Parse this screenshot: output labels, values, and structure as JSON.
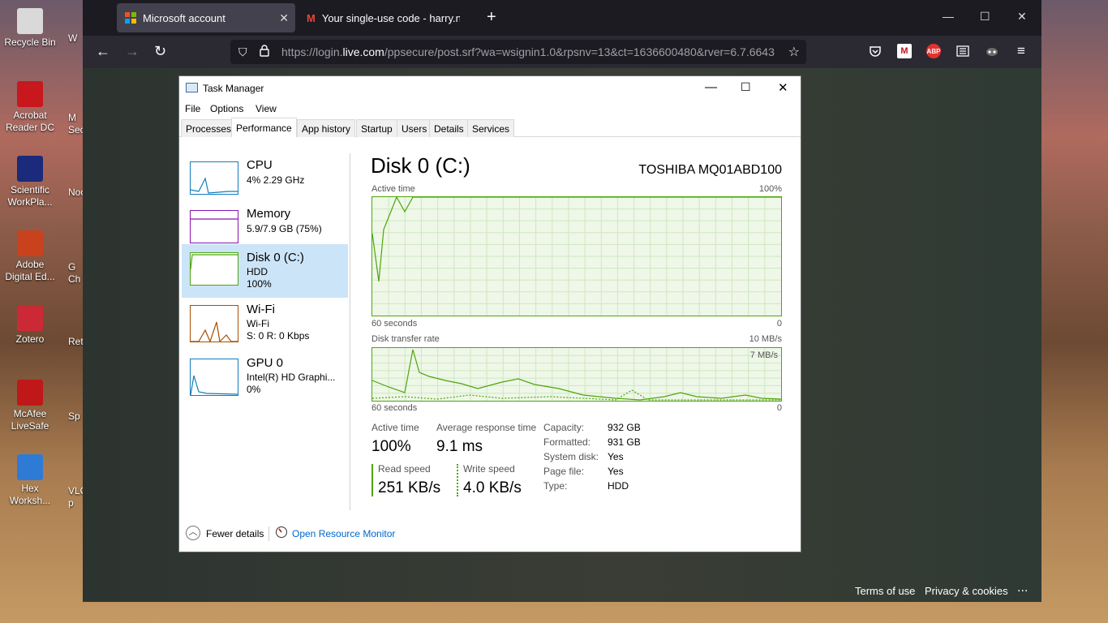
{
  "desktop": {
    "icons": [
      {
        "label": "Recycle Bin",
        "color": "#d9d9d9"
      },
      {
        "label": "Acrobat Reader DC",
        "color": "#c8171d"
      },
      {
        "label": "Scientific WorkPla...",
        "color": "#1b2a7a"
      },
      {
        "label": "Adobe Digital Ed...",
        "color": "#c8421d"
      },
      {
        "label": "Zotero",
        "color": "#cc2936"
      },
      {
        "label": "McAfee LiveSafe",
        "color": "#c01818"
      },
      {
        "label": "Hex Worksh...",
        "color": "#2e7bd6"
      }
    ],
    "cut_labels": [
      "W",
      "M",
      "Secu",
      "Noo",
      "G",
      "Ch",
      "Ret",
      "Sp",
      "VLC",
      "p"
    ]
  },
  "browser": {
    "tabs": [
      {
        "title": "Microsoft account",
        "icon": "microsoft-logo",
        "active": true
      },
      {
        "title": "Your single-use code - harry.no",
        "icon": "gmail-icon",
        "active": false
      }
    ],
    "new_tab": "+",
    "url_prefix": "https://login.",
    "url_domain": "live.com",
    "url_rest": "/ppsecure/post.srf?wa=wsignin1.0&rpsnv=13&ct=1636600480&rver=6.7.6643",
    "toolbar_icons": [
      "pocket-icon",
      "mcafee-icon",
      "abp-icon",
      "reader-icon",
      "privacy-badger-icon",
      "menu-icon"
    ],
    "abp_label": "ABP",
    "footer_links": [
      "Terms of use",
      "Privacy & cookies"
    ],
    "footer_more": "..."
  },
  "task_manager": {
    "title": "Task Manager",
    "menu": [
      "File",
      "Options",
      "View"
    ],
    "tabs": [
      "Processes",
      "Performance",
      "App history",
      "Startup",
      "Users",
      "Details",
      "Services"
    ],
    "active_tab": "Performance",
    "sidebar": [
      {
        "name": "CPU",
        "line1": "4%  2.29 GHz",
        "line2": "",
        "color": "#117dbb",
        "selected": false
      },
      {
        "name": "Memory",
        "line1": "5.9/7.9 GB (75%)",
        "line2": "",
        "color": "#8b12ae",
        "selected": false
      },
      {
        "name": "Disk 0 (C:)",
        "line1": "HDD",
        "line2": "100%",
        "color": "#4da60c",
        "selected": true
      },
      {
        "name": "Wi-Fi",
        "line1": "Wi-Fi",
        "line2": "S: 0  R: 0 Kbps",
        "color": "#a74f01",
        "selected": false
      },
      {
        "name": "GPU 0",
        "line1": "Intel(R) HD Graphi...",
        "line2": "0%",
        "color": "#117dbb",
        "selected": false
      }
    ],
    "main": {
      "title": "Disk 0 (C:)",
      "model": "TOSHIBA MQ01ABD100",
      "active_time_graph": {
        "label": "Active time",
        "max": "100%",
        "time": "60 seconds",
        "min": "0"
      },
      "transfer_graph": {
        "label": "Disk transfer rate",
        "max": "10 MB/s",
        "inner_max": "7 MB/s",
        "time": "60 seconds",
        "min": "0"
      },
      "stats": {
        "active_time_label": "Active time",
        "active_time_value": "100%",
        "avg_response_label": "Average response time",
        "avg_response_value": "9.1 ms",
        "read_label": "Read speed",
        "read_value": "251 KB/s",
        "write_label": "Write speed",
        "write_value": "4.0 KB/s"
      },
      "properties": [
        {
          "key": "Capacity:",
          "value": "932 GB"
        },
        {
          "key": "Formatted:",
          "value": "931 GB"
        },
        {
          "key": "System disk:",
          "value": "Yes"
        },
        {
          "key": "Page file:",
          "value": "Yes"
        },
        {
          "key": "Type:",
          "value": "HDD"
        }
      ]
    },
    "footer": {
      "fewer_details": "Fewer details",
      "resource_monitor": "Open Resource Monitor"
    }
  }
}
